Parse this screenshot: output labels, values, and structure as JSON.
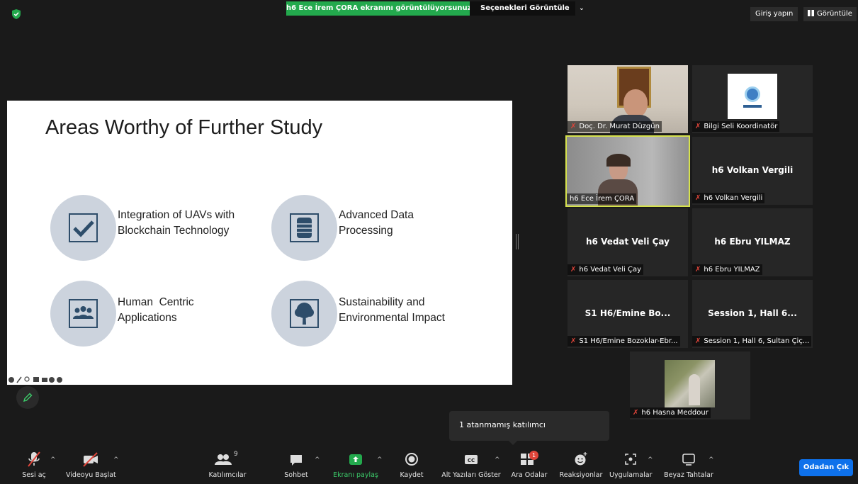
{
  "top_bar": {
    "share_banner": "h6 Ece İrem ÇORA ekranını görüntülüyorsunuz",
    "view_options": "Seçenekleri Görüntüle",
    "signin": "Giriş yapın",
    "view": "Görüntüle"
  },
  "slide": {
    "title": "Areas Worthy of Further Study",
    "items": [
      {
        "line1": "Integration of UAVs with",
        "line2": "Blockchain Technology",
        "icon": "checkmark-icon"
      },
      {
        "line1": "Advanced Data",
        "line2": "Processing",
        "icon": "database-icon"
      },
      {
        "line1": "Human  Centric",
        "line2": "Applications",
        "icon": "people-icon"
      },
      {
        "line1": "Sustainability and",
        "line2": "Environmental Impact",
        "icon": "tree-icon"
      }
    ]
  },
  "participants": [
    {
      "label": "Doç. Dr. Murat Düzgün",
      "muted": true,
      "video": true
    },
    {
      "label": "Bilgi Seli Koordinatör",
      "muted": true,
      "video": true
    },
    {
      "label": "h6 Ece İrem ÇORA",
      "muted": false,
      "video": true,
      "active_speaker": true
    },
    {
      "center": "h6 Volkan Vergili",
      "label": "h6 Volkan Vergili",
      "muted": true
    },
    {
      "center": "h6 Vedat Veli Çay",
      "label": "h6 Vedat Veli Çay",
      "muted": true
    },
    {
      "center": "h6 Ebru YILMAZ",
      "label": "h6 Ebru YILMAZ",
      "muted": true
    },
    {
      "center": "S1 H6/Emine Bo...",
      "label": "S1 H6/Emine Bozoklar-Ebr...",
      "muted": true
    },
    {
      "center": "Session 1, Hall 6...",
      "label": "Session 1, Hall 6, Sultan Çiç...",
      "muted": true
    },
    {
      "label": "h6 Hasna Meddour",
      "muted": true,
      "video": true
    }
  ],
  "tooltip": "1 atanmamış katılımcı",
  "toolbar": {
    "unmute": "Sesi aç",
    "start_video": "Videoyu Başlat",
    "participants": "Katılımcılar",
    "participant_count": "9",
    "chat": "Sohbet",
    "share_screen": "Ekranı paylaş",
    "record": "Kaydet",
    "captions": "Alt Yazıları Göster",
    "breakout": "Ara Odalar",
    "breakout_badge": "1",
    "reactions": "Reaksiyonlar",
    "apps": "Uygulamalar",
    "whiteboard": "Beyaz Tahtalar",
    "leave": "Odadan Çık"
  },
  "colors": {
    "share_banner": "#23a94d",
    "active_speaker_border": "#d6e24d",
    "leave_button": "#0e71eb",
    "muted_icon": "#e0453a",
    "icon_circle": "#ccd3dd",
    "icon_dark": "#2e4d6a"
  }
}
